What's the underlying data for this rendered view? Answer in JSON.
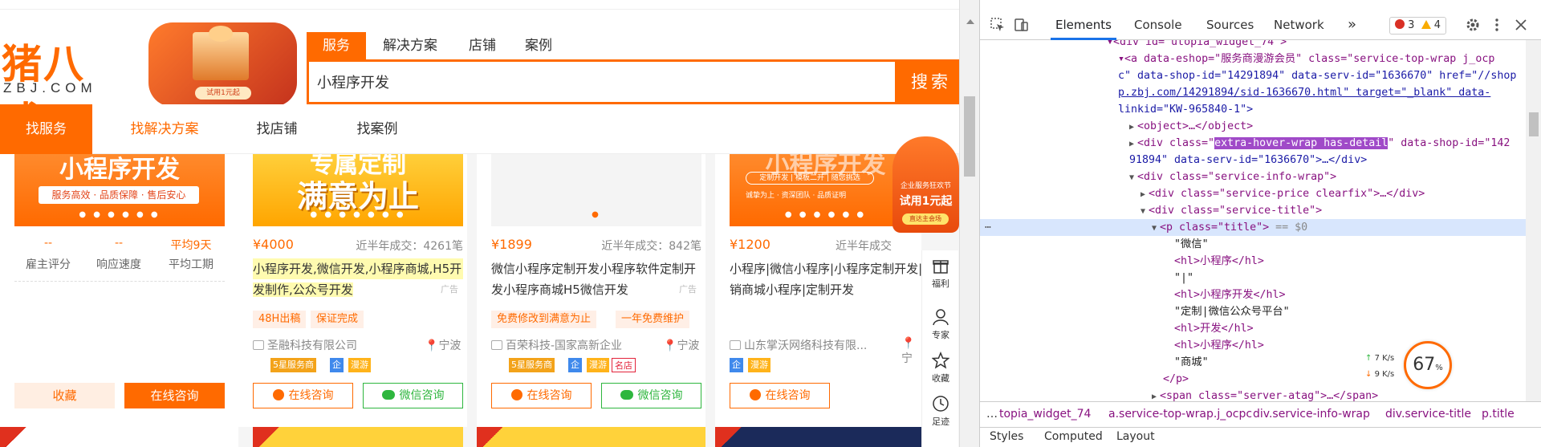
{
  "site": {
    "logo_cn": "猪八戒",
    "logo_en": "ZBJ.COM",
    "promo_tag": "试用1元起"
  },
  "search": {
    "tabs": [
      "服务",
      "解决方案",
      "店铺",
      "案例"
    ],
    "value": "小程序开发",
    "button": "搜索"
  },
  "nav": {
    "items": [
      "找服务",
      "找解决方案",
      "找店铺",
      "找案例"
    ]
  },
  "left_panel": {
    "banner_text": "小程序开发",
    "banner_sub": "服务高效 · 品质保障 · 售后安心",
    "stats": [
      {
        "value": "--",
        "label": "雇主评分"
      },
      {
        "value": "--",
        "label": "响应速度"
      },
      {
        "value": "平均9天",
        "label": "平均工期"
      }
    ],
    "fav_label": "收藏",
    "consult_label": "在线咨询"
  },
  "cards": [
    {
      "banner_text": "满意为止",
      "banner_top": "专属定制",
      "price": "¥4000",
      "sold": "近半年成交：4261笔",
      "title_line1": "小程序开发,微信开发,小程序商城,H5开",
      "title_line2": "发制作,公众号开发",
      "ad": "广告",
      "chips": [
        "48H出稿",
        "保证完成"
      ],
      "shop": "圣融科技有限公司",
      "city": "宁波",
      "badges": [
        "5星服务商",
        "企",
        "漫游"
      ],
      "btn1": "在线咨询",
      "btn2": "微信咨询"
    },
    {
      "price": "¥1899",
      "sold": "近半年成交：842笔",
      "title_line1": "微信小程序定制开发小程序软件定制开",
      "title_line2": "发小程序商城H5微信开发",
      "ad": "广告",
      "chips": [
        "免费修改到满意为止",
        "一年免费维护"
      ],
      "shop": "百荣科技-国家高新企业",
      "city": "宁波",
      "badges": [
        "5星服务商",
        "企",
        "漫游",
        "名店"
      ],
      "btn1": "在线咨询",
      "btn2": "微信咨询"
    },
    {
      "banner_text": "小程序开发",
      "banner_sub1": "定制开发 | 模板二开 | 随您挑选",
      "banner_sub2": "诚挚为上 · 资深团队 · 品质证明",
      "price": "¥1200",
      "sold": "近半年成交",
      "title_line1": "小程序|微信小程序|小程序定制开发|分",
      "title_line2": "销商城小程序|定制开发",
      "shop": "山东掌沃网络科技有限...",
      "city": "宁",
      "badges": [
        "企",
        "漫游"
      ],
      "btn1": "在线咨询"
    }
  ],
  "float_badge": {
    "line1": "企业服务狂欢节",
    "line2": "试用1元起",
    "line3": "直达主会场"
  },
  "side_bar": [
    "福利",
    "专家",
    "收藏",
    "足迹"
  ],
  "devtools": {
    "tabs": [
      "Elements",
      "Console",
      "Sources",
      "Network"
    ],
    "more": "»",
    "errors": "3",
    "warnings": "4",
    "lines": [
      {
        "indent": 0,
        "text": "<div id=\"utopia_widget_74\">"
      },
      {
        "indent": 1,
        "tag": "a",
        "attrs": "data-eshop=\"服务商漫游会员\" class=\"service-top-wrap j_ocp"
      },
      {
        "indent": 1,
        "cont": "c\" data-shop-id=\"14291894\" data-serv-id=\"1636670\" href=\"//shop.zbj.com/14291894/sid-1636670.html\" target=\"_blank\" data-linkid=\"KW-965840-1\">"
      }
    ],
    "object_line": "<object>…</object>",
    "hover_class": "extra-hover-wrap has-detail",
    "code": {
      "l1": "▾<div id=\"utopia_widget_74\">",
      "l2a": "▾<a data-eshop=\"服务商漫游会员\" class=\"service-top-wrap j_ocp",
      "l2b": "c\" data-shop-id=\"14291894\" data-serv-id=\"1636670\" href=\"//shop",
      "l2c": "p.zbj.com/14291894/sid-1636670.html\" target=\"_blank\" data-",
      "l2d": "linkid=\"KW-965840-1\">",
      "l3": "<object>…</object>",
      "l4a": "<div class=\"",
      "l4b": "extra-hover-wrap has-detail",
      "l4c": "\" data-shop-id=\"142",
      "l4d": "91894\" data-serv-id=\"1636670\">…</div>",
      "l5": "<div class=\"service-info-wrap\">",
      "l6": "<div class=\"service-price clearfix\">…</div>",
      "l7": "<div class=\"service-title\">",
      "l8": "<p class=\"title\">",
      "l8b": "== $0",
      "l9": "\"微信\"",
      "l10": "<hl>小程序</hl>",
      "l11": "\"|\"",
      "l12": "<hl>小程序开发</hl>",
      "l13": "\"定制|微信公众号平台\"",
      "l14": "<hl>开发</hl>",
      "l15": "<hl>小程序</hl>",
      "l16": "\"商城\"",
      "l17": "</p>",
      "l18": "<span class=\"server-atag\">…</span>"
    },
    "breadcrumb": [
      "topia_widget_74",
      "a.service-top-wrap.j_ocpc",
      "div.service-info-wrap",
      "div.service-title",
      "p.title"
    ],
    "crumb_more": "…",
    "subtabs": [
      "Styles",
      "Computed",
      "Layout"
    ],
    "net_up": "7 K/s",
    "net_down": "9 K/s",
    "gauge": "67",
    "gauge_unit": "%"
  }
}
